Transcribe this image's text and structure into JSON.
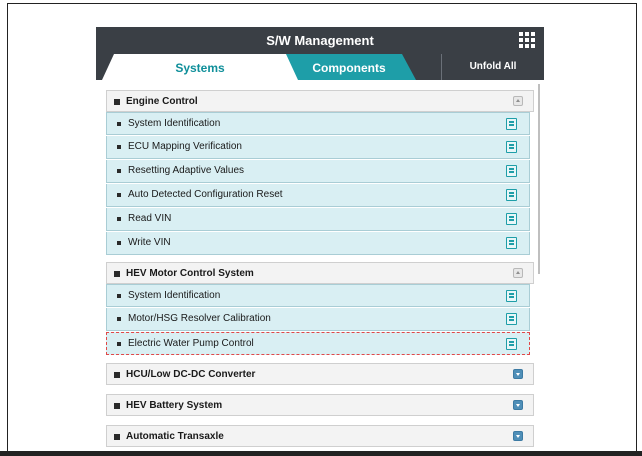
{
  "window": {
    "title": "S/W Management"
  },
  "tabs": [
    {
      "label": "Systems",
      "active": true
    },
    {
      "label": "Components",
      "active": false
    }
  ],
  "toolbar": {
    "unfold_label": "Unfold All"
  },
  "colors": {
    "titlebar": "#3a3f45",
    "accent": "#1e9ea8",
    "item_bg": "#d9eff3",
    "selection": "#e04848"
  },
  "groups": [
    {
      "title": "Engine Control",
      "toggle_icon": "collapse-icon",
      "items": [
        "System Identification",
        "ECU Mapping Verification",
        "Resetting Adaptive Values",
        "Auto Detected Configuration Reset",
        "Read VIN",
        "Write VIN"
      ]
    },
    {
      "title": "HEV Motor Control System",
      "toggle_icon": "collapse-icon",
      "items": [
        "System Identification",
        "Motor/HSG Resolver Calibration",
        "Electric Water Pump Control"
      ],
      "selected_item": "Electric Water Pump Control"
    },
    {
      "title": "HCU/Low DC-DC Converter",
      "toggle_icon": "expand-icon"
    },
    {
      "title": "HEV Battery System",
      "toggle_icon": "expand-icon"
    },
    {
      "title": "Automatic Transaxle",
      "toggle_icon": "expand-icon"
    }
  ]
}
